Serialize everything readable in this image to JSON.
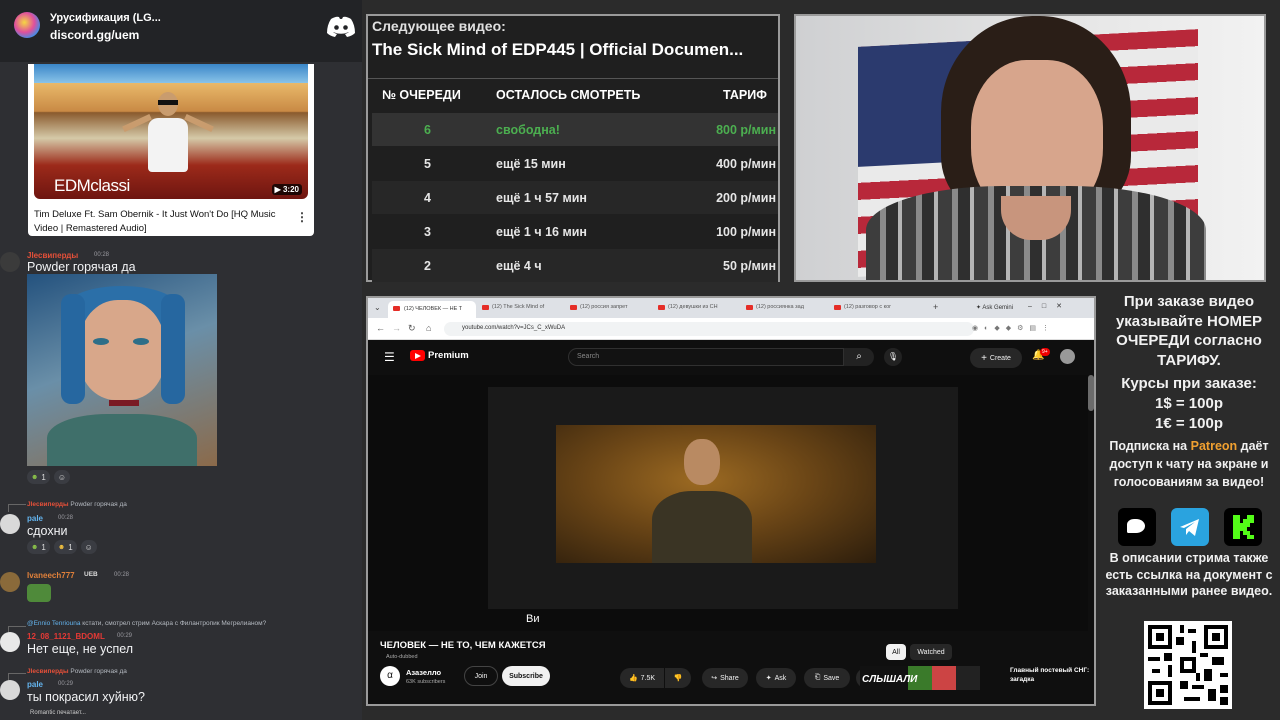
{
  "chat": {
    "server_name": "Урусификация (LG...",
    "server_link": "discord.gg/uem",
    "video_card": {
      "title": "Tim Deluxe Ft. Sam Obernik - It Just Won't Do [HQ Music Video | Remastered Audio]",
      "duration": "3:20",
      "thumb_caption": "EDMclassi"
    },
    "messages": [
      {
        "name": "Jlесвиперды",
        "time": "00:28",
        "text": "Powder горячая да",
        "reactions": [
          "1",
          "☺"
        ]
      },
      {
        "reply_name": "Jlесвиперды",
        "reply_text": "Powder горячая да",
        "name": "pale",
        "time": "00:28",
        "text": "сдохни",
        "reactions": [
          "1",
          "1",
          "☺"
        ]
      },
      {
        "name": "Ivaneech777",
        "badge": "UEB",
        "time": "00:28",
        "text": ""
      },
      {
        "reply_name": "@Ennio Tenriouna",
        "reply_text": "кстати, смотрел стрим Аскара с Филантропик Мегрелианом?",
        "name": "12_08_1121_BDOML",
        "time": "00:29",
        "text": "Нет еще, не успел"
      },
      {
        "reply_name": "Jlесвиперды",
        "reply_text": "Powder горячая да",
        "name": "pale",
        "time": "00:29",
        "text": "ты покрасил хуйню?"
      }
    ],
    "typing": "Romantic печатает..."
  },
  "queue": {
    "next_label": "Следующее видео:",
    "next_title": "The Sick Mind of EDP445 | Official Documen...",
    "headers": [
      "№ ОЧЕРЕДИ",
      "ОСТАЛОСЬ СМОТРЕТЬ",
      "ТАРИФ"
    ],
    "rows": [
      {
        "num": "6",
        "remaining": "свободна!",
        "rate": "800 р/мин"
      },
      {
        "num": "5",
        "remaining": "ещё 15 мин",
        "rate": "400 р/мин"
      },
      {
        "num": "4",
        "remaining": "ещё 1 ч 57 мин",
        "rate": "200 р/мин"
      },
      {
        "num": "3",
        "remaining": "ещё 1 ч 16 мин",
        "rate": "100 р/мин"
      },
      {
        "num": "2",
        "remaining": "ещё 4 ч",
        "rate": "50 р/мин"
      }
    ],
    "highlight_color": "#4caf50"
  },
  "browser": {
    "tabs": [
      "(12) ЧЕЛОВЕК — НЕ Т",
      "(12) The Sick Mind of",
      "(12) россия запрет",
      "(12) девушки из СН",
      "(12) россиянка зад",
      "(12) разговор с ког"
    ],
    "ask_gemini": "Ask Gemini",
    "url": "youtube.com/watch?v=JCs_C_xWuDA",
    "yt": {
      "logo": "Premium",
      "search_placeholder": "Search",
      "create": "Create",
      "notif_count": "9+",
      "subtitle": "Ви",
      "video_title": "ЧЕЛОВЕК — НЕ ТО, ЧЕМ КАЖЕТСЯ",
      "dubbed": "Auto-dubbed",
      "channel": "Азазелло",
      "subscribers": "63K subscribers",
      "join": "Join",
      "subscribe": "Subscribe",
      "likes": "7.5K",
      "share": "Share",
      "ask": "Ask",
      "save": "Save",
      "chip_all": "All",
      "chip_watched": "Watched",
      "side_title": "Главный постевый СНГ: загадка",
      "side_thumb_text": "СЛЫШАЛИ"
    }
  },
  "info": {
    "order_text": "При заказе видео указывайте НОМЕР ОЧЕРЕДИ согласно ТАРИФУ.",
    "rates_title": "Курсы при заказе:",
    "rate_usd": "1$ = 100р",
    "rate_eur": "1€ = 100р",
    "sub_pre": "Подписка на",
    "sub_brand": "Patreon",
    "sub_post": "даёт доступ к чату на экране и голосованиям за видео!",
    "doc_text": "В описании стрима также есть ссылка на документ с заказанными ранее видео.",
    "patreon_color": "#f0a030"
  }
}
